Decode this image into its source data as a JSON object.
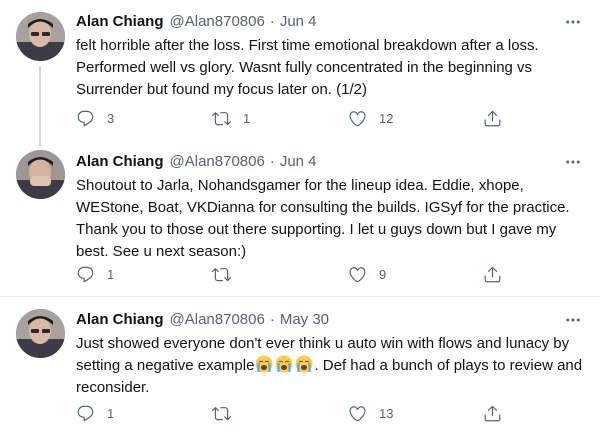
{
  "tweets": [
    {
      "author_name": "Alan Chiang",
      "handle": "@Alan870806",
      "separator": "·",
      "date": "Jun 4",
      "text": "felt horrible after the loss. First time emotional breakdown after a loss. Performed well vs glory. Wasnt fully concentrated in the beginning vs Surrender but found my focus later on. (1/2)",
      "replies": "3",
      "retweets": "1",
      "likes": "12"
    },
    {
      "author_name": "Alan Chiang",
      "handle": "@Alan870806",
      "separator": "·",
      "date": "Jun 4",
      "text": "Shoutout to Jarla, Nohandsgamer for the lineup idea. Eddie, xhope, WEStone, Boat, VKDianna for consulting the builds. IGSyf for the practice. Thank you to those out there supporting. I let u guys down but I gave my best. See u next season:)",
      "replies": "1",
      "retweets": "",
      "likes": "9"
    },
    {
      "author_name": "Alan Chiang",
      "handle": "@Alan870806",
      "separator": "·",
      "date": "May 30",
      "text_before_emoji": "Just showed everyone don't ever think u auto win with flows and lunacy by setting a negative example",
      "text_after_emoji": ". Def had a bunch of plays to review and reconsider.",
      "emoji_count": 3,
      "emoji_name": "loudly-crying-face-emoji",
      "replies": "1",
      "retweets": "",
      "likes": "13"
    }
  ],
  "colors": {
    "text": "#0f1419",
    "muted": "#536471",
    "divider": "#e6ecf0",
    "thread_line": "#cfd9de"
  },
  "icons": [
    "more-icon",
    "reply-icon",
    "retweet-icon",
    "like-icon",
    "share-icon"
  ]
}
